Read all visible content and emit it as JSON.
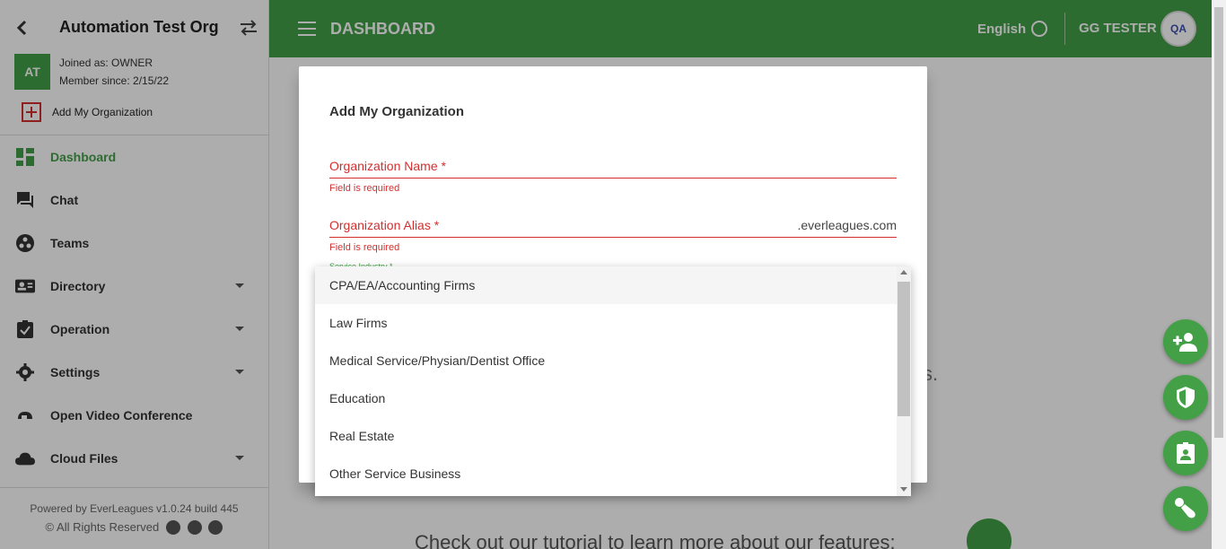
{
  "sidebar": {
    "org_title": "Automation Test Org",
    "avatar_initials": "AT",
    "joined_as": "Joined as: OWNER",
    "member_since": "Member since: 2/15/22",
    "add_org_label": "Add My Organization",
    "nav": [
      {
        "label": "Dashboard",
        "icon": "dashboard-icon",
        "active": true
      },
      {
        "label": "Chat",
        "icon": "chat-icon"
      },
      {
        "label": "Teams",
        "icon": "teams-icon"
      },
      {
        "label": "Directory",
        "icon": "directory-icon",
        "expandable": true
      },
      {
        "label": "Operation",
        "icon": "operation-icon",
        "expandable": true
      },
      {
        "label": "Settings",
        "icon": "gear-icon",
        "expandable": true
      },
      {
        "label": "Open Video Conference",
        "icon": "video-conference-icon"
      },
      {
        "label": "Cloud Files",
        "icon": "cloud-icon",
        "expandable": true
      }
    ],
    "footer_line1": "Powered by EverLeagues v1.0.24 build 445",
    "footer_line2": "© All Rights Reserved"
  },
  "topbar": {
    "title": "DASHBOARD",
    "language": "English",
    "user_name": "GG TESTER",
    "avatar_text": "QA",
    "accent": "#43a047"
  },
  "background": {
    "fragment": "s.",
    "tutorial": "Check out our tutorial to learn more about our features:"
  },
  "dialog": {
    "title": "Add My Organization",
    "org_name_label": "Organization Name *",
    "org_name_error": "Field is required",
    "org_alias_label": "Organization Alias *",
    "org_alias_suffix": ".everleagues.com",
    "org_alias_error": "Field is required",
    "service_industry_label": "Service Industry *"
  },
  "dropdown": {
    "options": [
      "CPA/EA/Accounting Firms",
      "Law Firms",
      "Medical Service/Physian/Dentist Office",
      "Education",
      "Real Estate",
      "Other Service Business"
    ]
  }
}
